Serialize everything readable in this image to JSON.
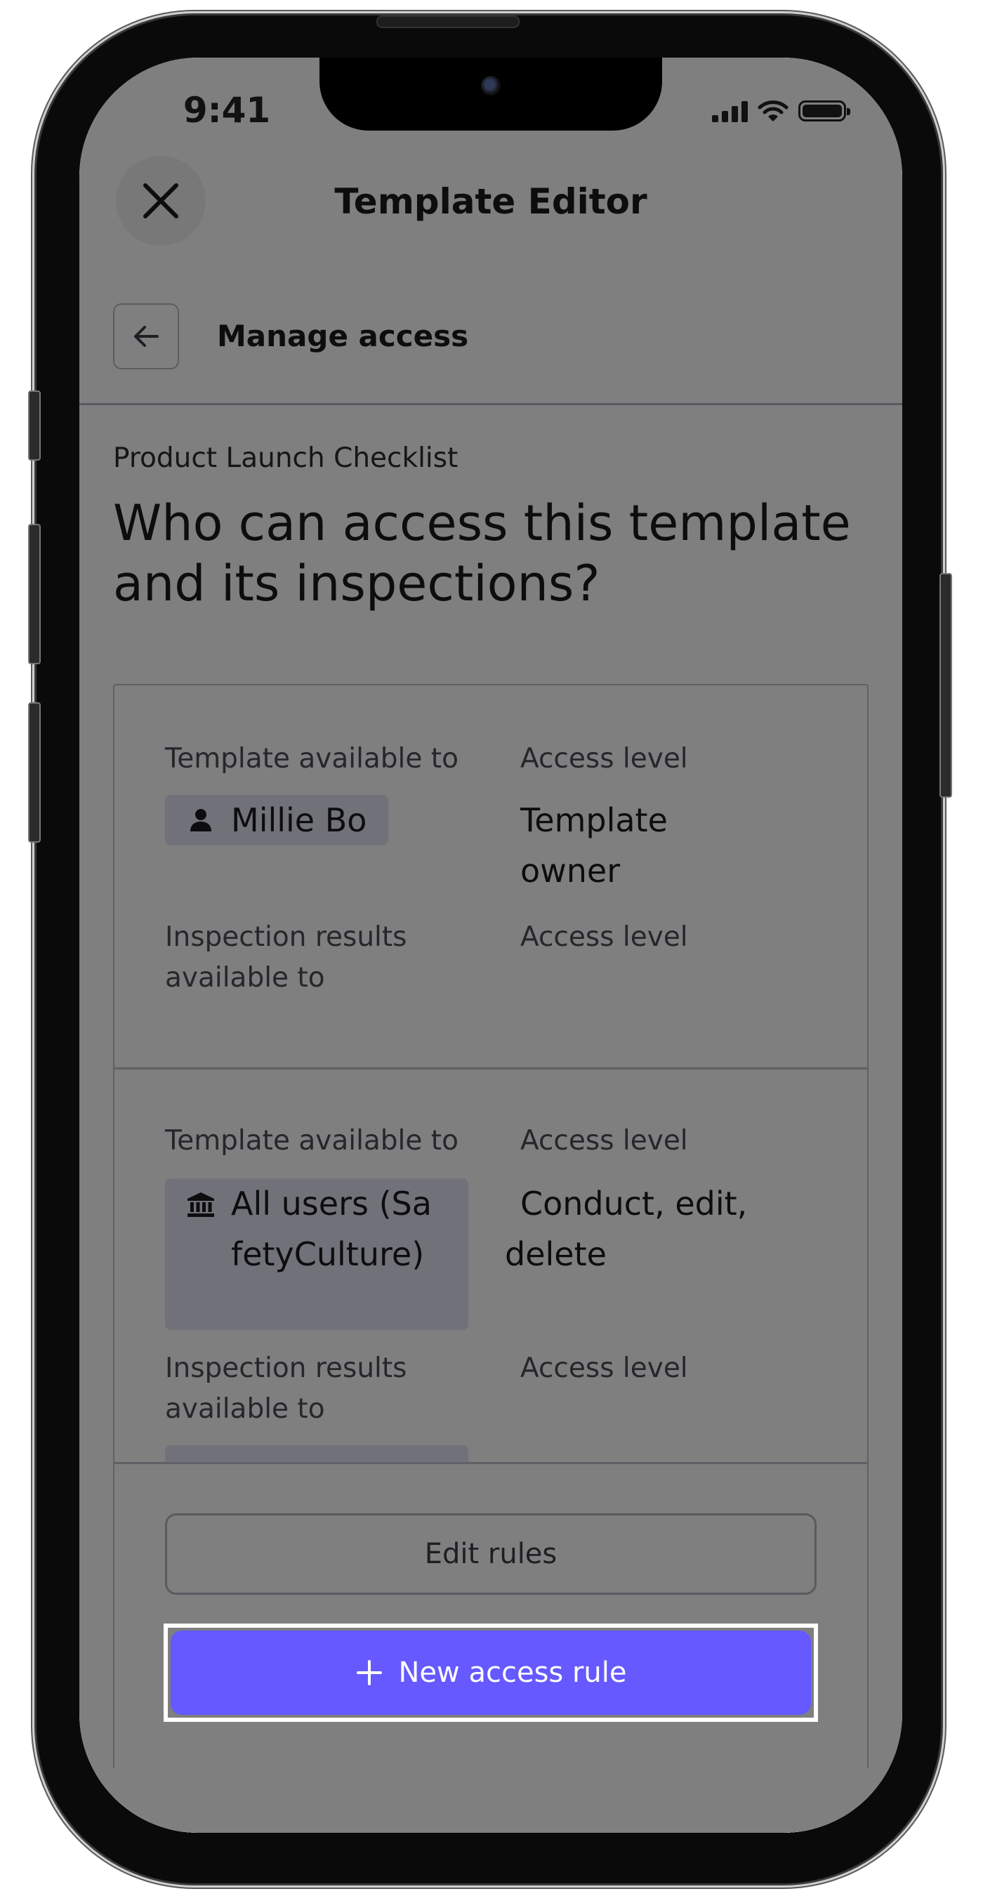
{
  "status_bar": {
    "time": "9:41"
  },
  "header": {
    "title": "Template Editor",
    "close_icon": "close-icon"
  },
  "subheader": {
    "back_icon": "arrow-left-icon",
    "title": "Manage access"
  },
  "page": {
    "template_name": "Product Launch Checklist",
    "headline": "Who can access this template and its inspections?"
  },
  "rules": [
    {
      "template_label": "Template available to",
      "template_access_label": "Access level",
      "assignee": "Millie Bo",
      "assignee_icon": "person-icon",
      "access_level": "Template owner",
      "results_label": "Inspection results available to",
      "results_access_label": "Access level"
    },
    {
      "template_label": "Template available to",
      "template_access_label": "Access level",
      "assignee": "All users (SafetyCulture)",
      "assignee_icon": "organization-icon",
      "access_level": "Conduct, edit, delete",
      "results_label": "Inspection results available to",
      "results_access_label": "Access level"
    }
  ],
  "actions": {
    "edit_rules": "Edit rules",
    "new_access_rule": "New access rule",
    "new_access_rule_icon": "plus-icon"
  },
  "colors": {
    "primary": "#6559ff",
    "chip_bg": "#e3e5f2",
    "overlay": "rgba(0,0,0,0.5)"
  }
}
